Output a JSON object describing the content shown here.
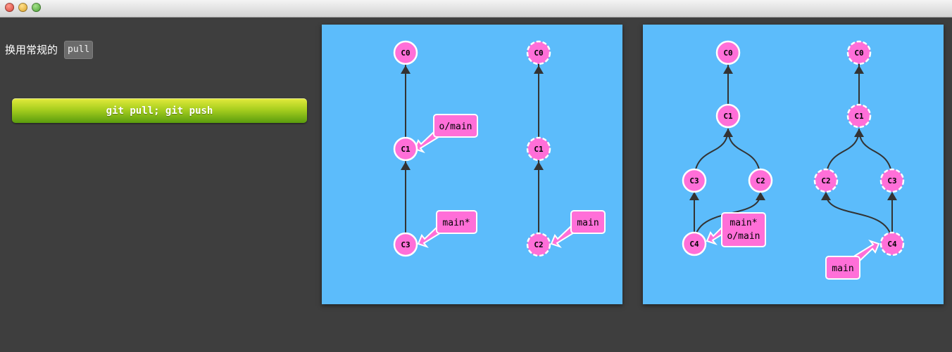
{
  "intro": {
    "text": "换用常规的",
    "code": "pull"
  },
  "command_button": {
    "label": "git pull; git push"
  },
  "colors": {
    "background": "#3e3e3e",
    "panel": "#5cbcfb",
    "node_fill": "#ff6fd8",
    "edge": "#333333",
    "button_top": "#e3ea3c",
    "button_bottom": "#5a9c0e"
  },
  "panels": [
    {
      "id": "before",
      "local": {
        "commits": [
          {
            "id": "C0",
            "label": "C0",
            "parent": []
          },
          {
            "id": "C1",
            "label": "C1",
            "parent": [
              "C0"
            ]
          },
          {
            "id": "C3",
            "label": "C3",
            "parent": [
              "C1"
            ]
          }
        ],
        "branches": [
          {
            "label": "o/main",
            "target": "C1"
          },
          {
            "label": "main*",
            "target": "C3"
          }
        ]
      },
      "remote": {
        "commits": [
          {
            "id": "C0",
            "label": "C0",
            "parent": []
          },
          {
            "id": "C1",
            "label": "C1",
            "parent": [
              "C0"
            ]
          },
          {
            "id": "C2",
            "label": "C2",
            "parent": [
              "C1"
            ]
          }
        ],
        "branches": [
          {
            "label": "main",
            "target": "C2"
          }
        ]
      }
    },
    {
      "id": "after",
      "local": {
        "commits": [
          {
            "id": "C0",
            "label": "C0",
            "parent": []
          },
          {
            "id": "C1",
            "label": "C1",
            "parent": [
              "C0"
            ]
          },
          {
            "id": "C3",
            "label": "C3",
            "parent": [
              "C1"
            ]
          },
          {
            "id": "C2",
            "label": "C2",
            "parent": [
              "C1"
            ]
          },
          {
            "id": "C4",
            "label": "C4",
            "parent": [
              "C3",
              "C2"
            ]
          }
        ],
        "branches": [
          {
            "label": "main*",
            "label2": "o/main",
            "target": "C4"
          }
        ]
      },
      "remote": {
        "commits": [
          {
            "id": "C0",
            "label": "C0",
            "parent": []
          },
          {
            "id": "C1",
            "label": "C1",
            "parent": [
              "C0"
            ]
          },
          {
            "id": "C2",
            "label": "C2",
            "parent": [
              "C1"
            ]
          },
          {
            "id": "C3",
            "label": "C3",
            "parent": [
              "C1"
            ]
          },
          {
            "id": "C4",
            "label": "C4",
            "parent": [
              "C3",
              "C2"
            ]
          }
        ],
        "branches": [
          {
            "label": "main",
            "target": "C4"
          }
        ]
      }
    }
  ]
}
